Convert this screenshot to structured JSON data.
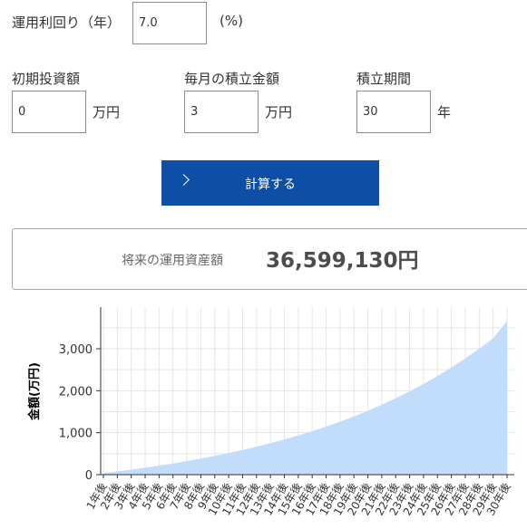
{
  "form": {
    "rate_label": "運用利回り（年）",
    "rate_value": "7.0",
    "rate_unit": "(%)",
    "initial_label": "初期投資額",
    "initial_value": "0",
    "initial_unit": "万円",
    "monthly_label": "毎月の積立金額",
    "monthly_value": "3",
    "monthly_unit": "万円",
    "period_label": "積立期間",
    "period_value": "30",
    "period_unit": "年"
  },
  "calculate_button": {
    "label": "計算する",
    "icon": "chevron-right-icon",
    "color": "#0d4ea6"
  },
  "result": {
    "label": "将来の運用資産額",
    "value": "36,599,130円"
  },
  "chart_data": {
    "type": "area",
    "ylabel": "金額(万円)",
    "xlabel": "",
    "ylim": [
      0,
      4000
    ],
    "y_ticks": [
      0,
      1000,
      2000,
      3000
    ],
    "y_tick_labels": [
      "0",
      "1,000",
      "2,000",
      "3,000"
    ],
    "grid": true,
    "fill_color": "#c2ddfb",
    "x": [
      "1年後",
      "2年後",
      "3年後",
      "4年後",
      "5年後",
      "6年後",
      "7年後",
      "8年後",
      "9年後",
      "10年後",
      "11年後",
      "12年後",
      "13年後",
      "14年後",
      "15年後",
      "16年後",
      "17年後",
      "18年後",
      "19年後",
      "20年後",
      "21年後",
      "22年後",
      "23年後",
      "24年後",
      "25年後",
      "26年後",
      "27年後",
      "28年後",
      "29年後",
      "30年後"
    ],
    "values": [
      37,
      77,
      120,
      166,
      216,
      268,
      324,
      384,
      448,
      516,
      589,
      667,
      750,
      839,
      934,
      1036,
      1145,
      1262,
      1388,
      1522,
      1666,
      1820,
      1985,
      2162,
      2351,
      2553,
      2770,
      3002,
      3250,
      3660
    ]
  }
}
